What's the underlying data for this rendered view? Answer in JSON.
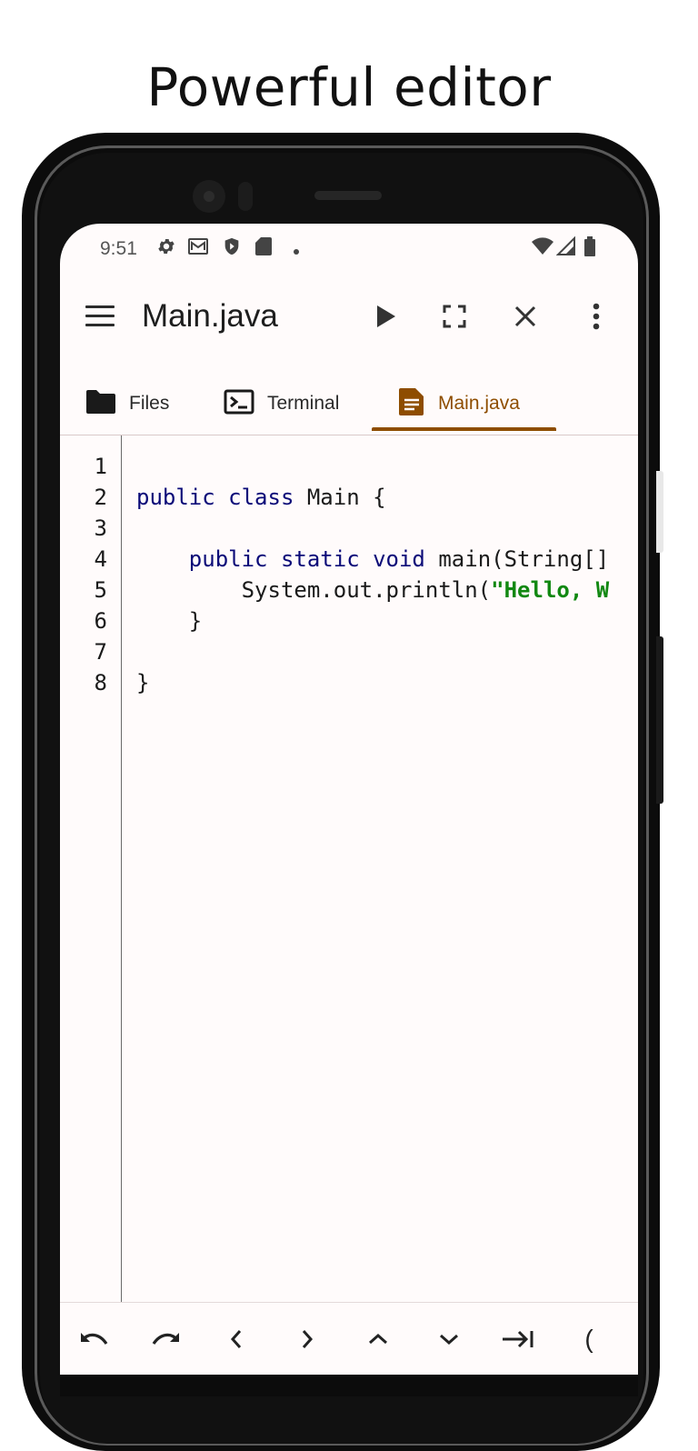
{
  "headline": "Powerful editor",
  "status_bar": {
    "time": "9:51",
    "left_icons": [
      "gear-icon",
      "mail-icon",
      "shield-icon",
      "sd-card-icon",
      "dot-icon"
    ],
    "right_icons": [
      "wifi-icon",
      "signal-icon",
      "battery-icon"
    ]
  },
  "app_bar": {
    "title": "Main.java",
    "actions": [
      "play-icon",
      "fullscreen-icon",
      "close-icon",
      "more-vert-icon"
    ]
  },
  "tabs": [
    {
      "label": "Files",
      "icon": "folder-icon",
      "active": false
    },
    {
      "label": "Terminal",
      "icon": "terminal-icon",
      "active": false
    },
    {
      "label": "Main.java",
      "icon": "document-icon",
      "active": true
    }
  ],
  "editor": {
    "line_numbers": [
      "1",
      "2",
      "3",
      "4",
      "5",
      "6",
      "7",
      "8"
    ],
    "lines": [
      [],
      [
        {
          "t": "public class",
          "c": "kw"
        },
        {
          "t": " Main {",
          "c": ""
        }
      ],
      [],
      [
        {
          "t": "    ",
          "c": ""
        },
        {
          "t": "public static void",
          "c": "kw"
        },
        {
          "t": " main(String[]",
          "c": ""
        }
      ],
      [
        {
          "t": "        System.out.println(",
          "c": ""
        },
        {
          "t": "\"Hello, W",
          "c": "str"
        }
      ],
      [
        {
          "t": "    }",
          "c": ""
        }
      ],
      [],
      [
        {
          "t": "}",
          "c": ""
        }
      ]
    ]
  },
  "keybar": {
    "keys": [
      "undo-icon",
      "redo-icon",
      "<",
      ">",
      "^",
      "v",
      "tab-icon",
      "("
    ]
  },
  "colors": {
    "accent": "#8e4d00",
    "keyword": "#0a0a78",
    "string": "#118811",
    "screen_bg": "#fffbfb"
  }
}
